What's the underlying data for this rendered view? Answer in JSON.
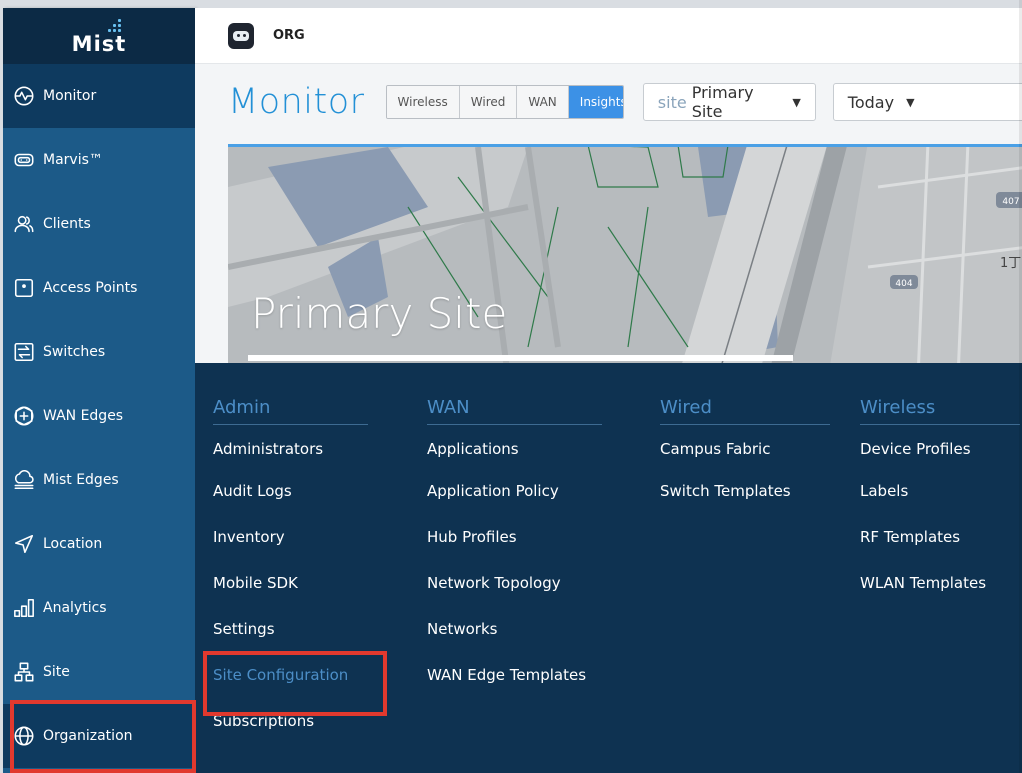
{
  "sidebar": {
    "logo_text": "Mist",
    "items": [
      {
        "label": "Monitor",
        "icon": "monitor-icon"
      },
      {
        "label": "Marvis™",
        "icon": "marvis-icon"
      },
      {
        "label": "Clients",
        "icon": "clients-icon"
      },
      {
        "label": "Access Points",
        "icon": "access-point-icon"
      },
      {
        "label": "Switches",
        "icon": "switch-icon"
      },
      {
        "label": "WAN Edges",
        "icon": "wan-edge-icon"
      },
      {
        "label": "Mist Edges",
        "icon": "mist-edge-icon"
      },
      {
        "label": "Location",
        "icon": "location-icon"
      },
      {
        "label": "Analytics",
        "icon": "analytics-icon"
      },
      {
        "label": "Site",
        "icon": "site-icon"
      },
      {
        "label": "Organization",
        "icon": "globe-icon"
      }
    ]
  },
  "header": {
    "org_name": "ORG"
  },
  "main": {
    "title": "Monitor",
    "tabs": [
      "Wireless",
      "Wired",
      "WAN",
      "Insights"
    ],
    "selected_tab": "Insights",
    "site_prefix": "site",
    "site_value": "Primary Site",
    "date_value": "Today",
    "map_title": "Primary Site",
    "map_labels": {
      "road": "404",
      "shield": "407",
      "street": "1丁"
    }
  },
  "menu": {
    "columns": [
      {
        "heading": "Admin",
        "items": [
          "Administrators",
          "Audit Logs",
          "Inventory",
          "Mobile SDK",
          "Settings",
          "Site Configuration",
          "Subscriptions"
        ]
      },
      {
        "heading": "WAN",
        "items": [
          "Applications",
          "Application Policy",
          "Hub Profiles",
          "Network Topology",
          "Networks",
          "WAN Edge Templates"
        ]
      },
      {
        "heading": "Wired",
        "items": [
          "Campus Fabric",
          "Switch Templates"
        ]
      },
      {
        "heading": "Wireless",
        "items": [
          "Device Profiles",
          "Labels",
          "RF Templates",
          "WLAN Templates"
        ]
      }
    ],
    "highlighted": "Site Configuration"
  },
  "colors": {
    "accent": "#2290d6",
    "sidebar": "#1c5a88",
    "menu_bg": "#0e3251",
    "highlight_box": "#e1392e"
  }
}
